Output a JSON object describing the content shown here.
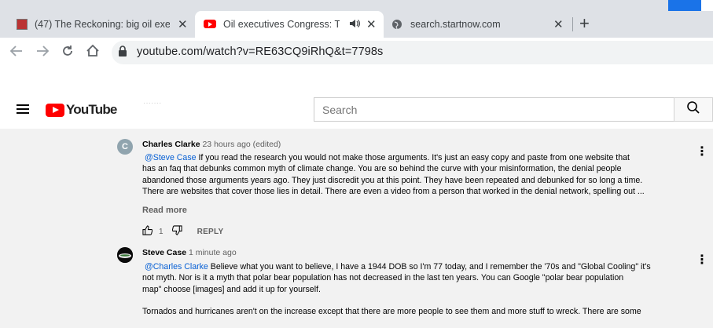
{
  "browser": {
    "tabs": [
      {
        "title": "(47) The Reckoning: big oil execs",
        "active": false
      },
      {
        "title": "Oil executives Congress: Top",
        "active": true
      },
      {
        "title": "search.startnow.com",
        "active": false
      }
    ],
    "url": "youtube.com/watch?v=RE63CQ9iRhQ&t=7798s"
  },
  "youtube": {
    "logo_text": "YouTube",
    "search_placeholder": "Search"
  },
  "comments": [
    {
      "author": "Charles Clarke",
      "avatar_letter": "C",
      "time": "23 hours ago (edited)",
      "mention": "@Steve Case",
      "lines": [
        " If you read the research you would not make those arguments.  It's just an easy copy and paste from one website that",
        "has an faq that debunks common myth of climate change.  You are so behind the curve with your misinformation, the denial people",
        "abandoned those arguments years ago.  They just discredit you at this point.  They have been repeated and debunked for so long a time.",
        "There are websites that cover those lies in detail.  There are even a video from a person that worked in the denial network, spelling out ..."
      ],
      "read_more": "Read more",
      "likes": "1",
      "reply_label": "REPLY"
    },
    {
      "author": "Steve Case",
      "time": "1 minute ago",
      "mention": "@Charles Clarke",
      "lines": [
        " Believe what you want to believe, I have a 1944 DOB so I'm 77 today, and I remember the '70s and \"Global Cooling\" it's",
        "not myth.  Nor is it a myth that polar bear population has not decreased in the last ten years.  You can Google \"polar bear population",
        "map\" choose [images] and add it up for yourself.",
        "",
        "Tornados and hurricanes aren't on the increase except that there are more people to see them and more stuff to wreck. There are some"
      ]
    }
  ]
}
